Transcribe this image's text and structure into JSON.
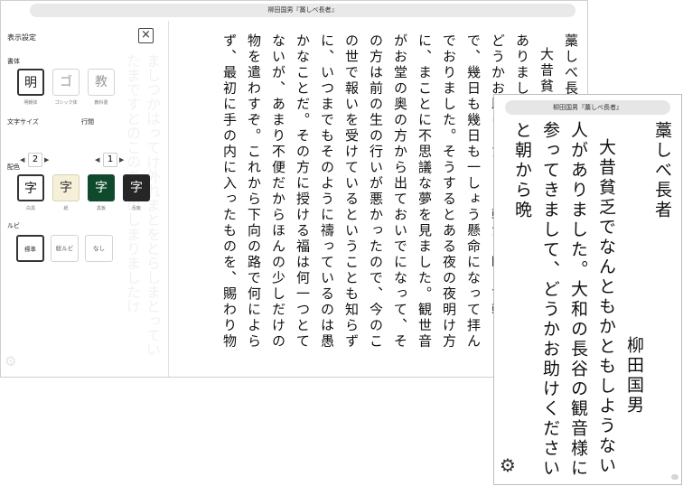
{
  "main_window": {
    "title": "柳田国男『藁しべ長者』",
    "ghost_text": "ましつかはってけ外れまとをとらしまとっていたまですとのこのこうのしまりましたけ"
  },
  "settings": {
    "title": "表示設定",
    "close_icon": "×",
    "font_section": {
      "label": "書体",
      "options": [
        {
          "glyph": "明",
          "caption": "明朝体",
          "selected": true
        },
        {
          "glyph": "ゴ",
          "caption": "ゴシック体",
          "selected": false
        },
        {
          "glyph": "教",
          "caption": "教科書",
          "selected": false
        }
      ]
    },
    "font_size": {
      "label": "文字サイズ",
      "value": "2",
      "left_arrow": "◀",
      "right_arrow": "▶"
    },
    "line_spacing": {
      "label": "行間",
      "value": "1",
      "left_arrow": "◀",
      "right_arrow": "▶"
    },
    "color_section": {
      "label": "配色",
      "options": [
        {
          "glyph": "字",
          "caption": "白黒",
          "bg": "#ffffff",
          "fg": "#111111",
          "selected": true
        },
        {
          "glyph": "字",
          "caption": "紙",
          "bg": "#f6f0d8",
          "fg": "#333333",
          "selected": false
        },
        {
          "glyph": "字",
          "caption": "黒板",
          "bg": "#0f4a2c",
          "fg": "#ffffff",
          "selected": false
        },
        {
          "glyph": "字",
          "caption": "反転",
          "bg": "#262626",
          "fg": "#ffffff",
          "selected": false
        }
      ]
    },
    "ruby_section": {
      "label": "ルビ",
      "options": [
        {
          "label": "標準",
          "selected": true
        },
        {
          "label": "総ルビ",
          "selected": false
        },
        {
          "label": "なし",
          "selected": false
        }
      ]
    },
    "gear_icon": "⚙"
  },
  "main_text": [
    "藁しべ長者",
    "大昔貧乏でなんともかともしようない人がありました。",
    "どうかお助けくださいと朝から晩まで朝まで、幾日も幾日も一しょう懸命になって拝んでおりました。そうするとある夜の夜明け方に、まことに不思議な夢を見ました。観世音がお堂の奥の方から出ておいでになって、その方は前の生の行いが悪かったので、今のこの世で報いを受けているということも知らずに、いつまでもそのように禱っているのは愚かなことだ。その方に授ける福は何一つとてないが、あまり不便だからほんの少しだけの物を遣わすぞ。これから下向の路で何によらず、最初に手の内に入ったものを、賜わり物"
  ],
  "phone": {
    "title": "柳田国男『藁しべ長者』",
    "work_title": "藁しべ長者",
    "work_author": "柳田国男",
    "body": "大昔貧乏でなんともかともしようない人がありました。大和の長谷の観音様に参ってきまして、どうかお助けくださいと朝から晩",
    "gear_icon": "⚙"
  }
}
